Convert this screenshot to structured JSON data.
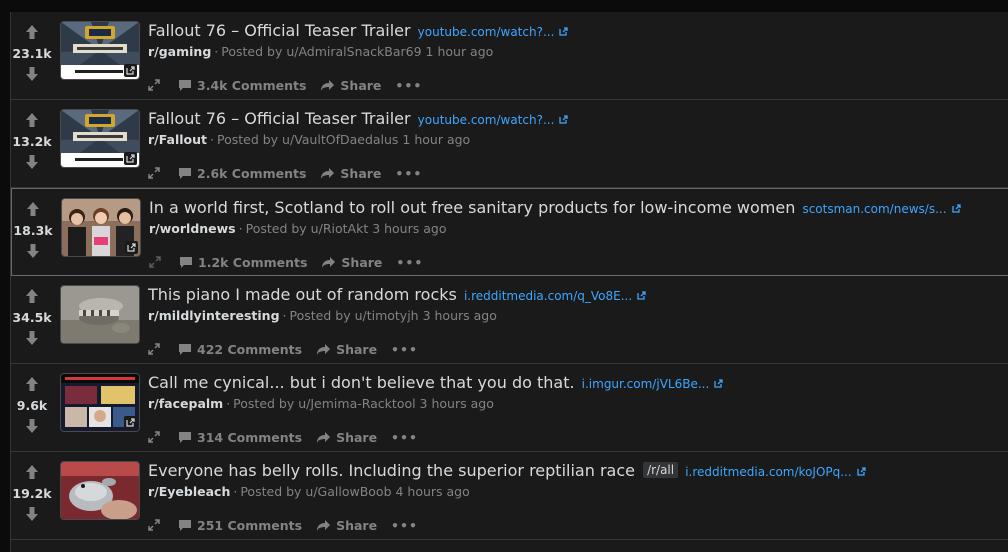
{
  "colors": {
    "background": "#1a1a1b",
    "text": "#d7dadc",
    "meta": "#818384",
    "link": "#3ea6ff",
    "divider": "#343536"
  },
  "icons": {
    "vote_up": "up-arrow-icon",
    "vote_down": "down-arrow-icon",
    "expand": "expand-icon",
    "comments": "comment-bubble-icon",
    "share": "share-arrow-icon",
    "more": "more-dots-icon",
    "external": "external-link-icon"
  },
  "labels": {
    "share": "Share",
    "more": "•••"
  },
  "posts": [
    {
      "score": "23.1k",
      "title": "Fallout 76 – Official Teaser Trailer",
      "flair": "",
      "domain": "youtube.com/watch?...",
      "subreddit": "r/gaming",
      "meta": "Posted by u/AdmiralSnackBar69 1 hour ago",
      "comments": "3.4k Comments",
      "thumb": "fallout"
    },
    {
      "score": "13.2k",
      "title": "Fallout 76 – Official Teaser Trailer",
      "flair": "",
      "domain": "youtube.com/watch?...",
      "subreddit": "r/Fallout",
      "meta": "Posted by u/VaultOfDaedalus 1 hour ago",
      "comments": "2.6k Comments",
      "thumb": "fallout"
    },
    {
      "score": "18.3k",
      "title": "In a world first, Scotland to roll out free sanitary products for low-income women",
      "flair": "",
      "domain": "scotsman.com/news/s...",
      "subreddit": "r/worldnews",
      "meta": "Posted by u/RiotAkt 3 hours ago",
      "comments": "1.2k Comments",
      "thumb": "people"
    },
    {
      "score": "34.5k",
      "title": "This piano I made out of random rocks",
      "flair": "",
      "domain": "i.redditmedia.com/q_Vo8E...",
      "subreddit": "r/mildlyinteresting",
      "meta": "Posted by u/timotyjh 3 hours ago",
      "comments": "422 Comments",
      "thumb": "rocks"
    },
    {
      "score": "9.6k",
      "title": "Call me cynical... but i don't believe that you do that.",
      "flair": "",
      "domain": "i.imgur.com/jVL6Be...",
      "subreddit": "r/facepalm",
      "meta": "Posted by u/Jemima-Racktool 3 hours ago",
      "comments": "314 Comments",
      "thumb": "meme"
    },
    {
      "score": "19.2k",
      "title": "Everyone has belly rolls. Including the superior reptilian race",
      "flair": "/r/all",
      "domain": "i.redditmedia.com/koJOPq...",
      "subreddit": "r/Eyebleach",
      "meta": "Posted by u/GallowBoob 4 hours ago",
      "comments": "251 Comments",
      "thumb": "lizard"
    }
  ]
}
